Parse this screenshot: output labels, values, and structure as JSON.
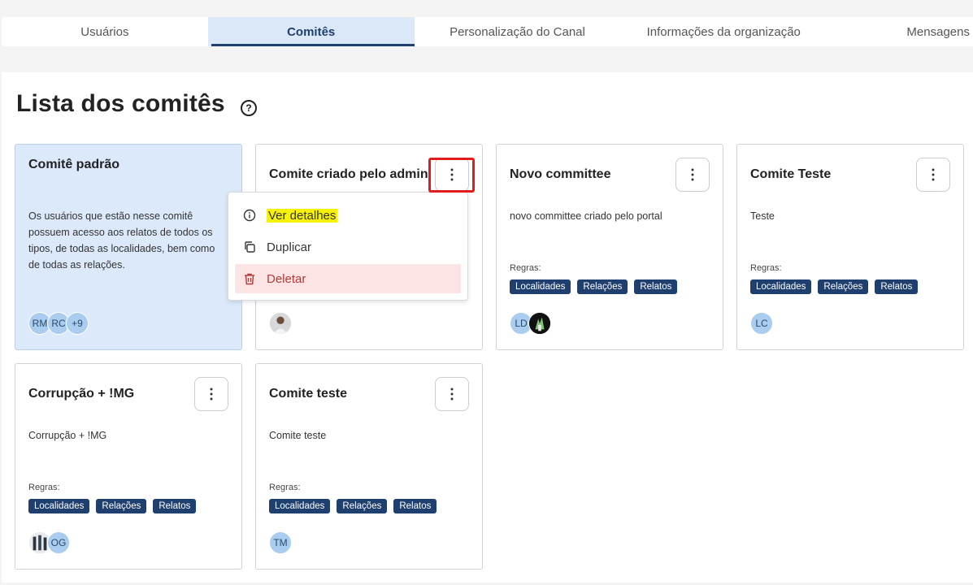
{
  "tabs": [
    {
      "label": "Usuários",
      "active": false
    },
    {
      "label": "Comitês",
      "active": true
    },
    {
      "label": "Personalização do Canal",
      "active": false
    },
    {
      "label": "Informações da organização",
      "active": false
    },
    {
      "label": "Mensagens",
      "active": false
    }
  ],
  "page": {
    "title": "Lista dos comitês",
    "help_icon": "help-circle-icon"
  },
  "colors": {
    "accent": "#1f3f6e",
    "tab_active_bg": "#dbe8f7",
    "default_card_bg": "#dbe9fa",
    "danger_bg": "#fde4e4",
    "highlight": "#f7f20a",
    "annotation_red": "#e01c1c"
  },
  "cards": [
    {
      "title": "Comitê padrão",
      "description": "Os usuários que estão nesse comitê possuem acesso aos relatos de todos os tipos, de todas as localidades, bem como de todas as relações.",
      "avatars": [
        "RM",
        "RC",
        "+9"
      ]
    },
    {
      "title": "Comite criado pelo admin",
      "avatars": []
    },
    {
      "title": "Novo committee",
      "description": "novo committee criado pelo portal",
      "rules_label": "Regras:",
      "tags": [
        "Localidades",
        "Relações",
        "Relatos"
      ],
      "avatars": [
        "LD"
      ]
    },
    {
      "title": "Comite Teste",
      "description": "Teste",
      "rules_label": "Regras:",
      "tags": [
        "Localidades",
        "Relações",
        "Relatos"
      ],
      "avatars": [
        "LC"
      ]
    },
    {
      "title": "Corrupção + !MG",
      "description": "Corrupção + !MG",
      "rules_label": "Regras:",
      "tags": [
        "Localidades",
        "Relações",
        "Relatos"
      ],
      "avatars": [
        "OG"
      ]
    },
    {
      "title": "Comite teste",
      "description": "Comite teste",
      "rules_label": "Regras:",
      "tags": [
        "Localidades",
        "Relações",
        "Relatos"
      ],
      "avatars": [
        "TM"
      ]
    }
  ],
  "menu": {
    "items": [
      {
        "label": "Ver detalhes",
        "icon": "info-icon"
      },
      {
        "label": "Duplicar",
        "icon": "copy-icon"
      },
      {
        "label": "Deletar",
        "icon": "trash-icon"
      }
    ]
  }
}
